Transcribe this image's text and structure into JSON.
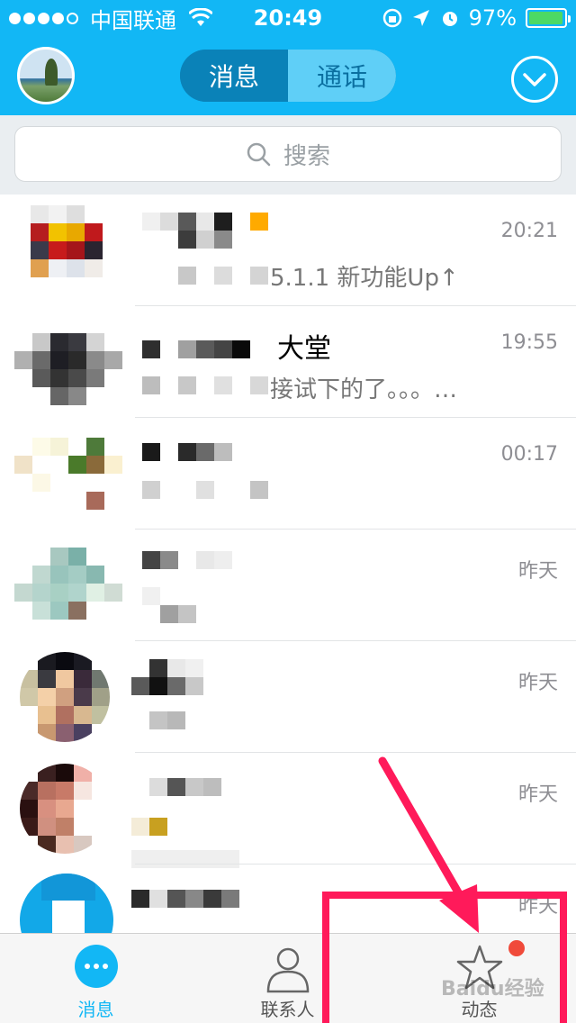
{
  "status_bar": {
    "carrier": "中国联通",
    "time": "20:49",
    "battery": "97%",
    "battery_level": 0.97
  },
  "header": {
    "tabs": [
      {
        "label": "消息",
        "active": true
      },
      {
        "label": "通话",
        "active": false
      }
    ]
  },
  "search": {
    "placeholder": "搜索"
  },
  "conversations": [
    {
      "title": "",
      "preview": "5.1.1 新功能Up↑",
      "time": "20:21"
    },
    {
      "title": "大堂",
      "preview": "接试下的了。。。…",
      "time": "19:55"
    },
    {
      "title": "",
      "preview": "",
      "time": "00:17"
    },
    {
      "title": "",
      "preview": "",
      "time": "昨天"
    },
    {
      "title": "",
      "preview": "",
      "time": "昨天"
    },
    {
      "title": "",
      "preview": "",
      "time": "昨天"
    },
    {
      "title": "",
      "preview": "",
      "time": "昨天"
    }
  ],
  "tab_bar": {
    "items": [
      {
        "label": "消息",
        "icon": "chat-bubble-icon",
        "active": true
      },
      {
        "label": "联系人",
        "icon": "person-icon",
        "active": false
      },
      {
        "label": "动态",
        "icon": "star-icon",
        "active": false,
        "badge": true
      }
    ]
  },
  "watermark": "Baidu经验",
  "colors": {
    "brand_blue": "#12b7f5",
    "annotation_pink": "#ff1a5a",
    "badge_red": "#f04a3a"
  }
}
